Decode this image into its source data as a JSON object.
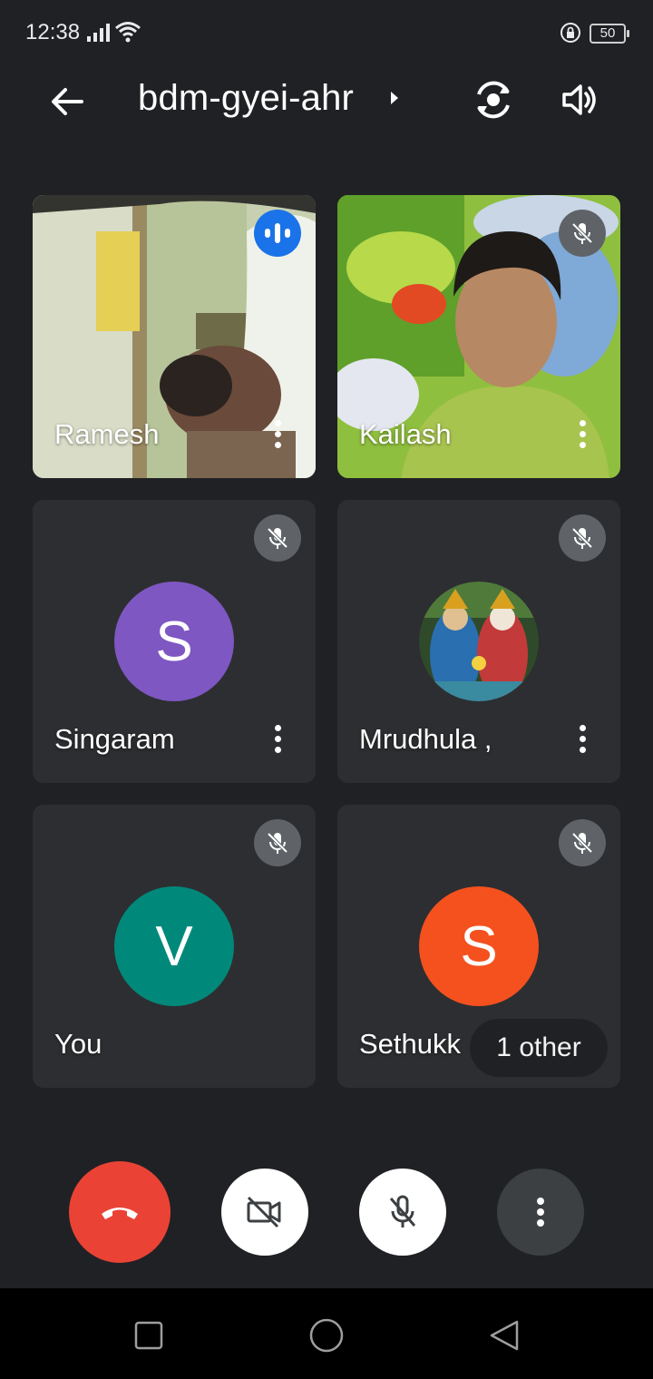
{
  "status": {
    "time": "12:38",
    "battery": "50"
  },
  "meeting": {
    "code": "bdm-gyei-ahr"
  },
  "participants": [
    {
      "name": "Ramesh",
      "state": "speaking"
    },
    {
      "name": "Kailash",
      "state": "muted"
    },
    {
      "name": "Singaram",
      "initial": "S",
      "avatar_color": "#7e57c2",
      "state": "muted"
    },
    {
      "name": "Mrudhula ,",
      "state": "muted"
    },
    {
      "name": "You",
      "initial": "V",
      "avatar_color": "#00897b",
      "state": "muted"
    },
    {
      "name": "Sethukk",
      "initial": "S",
      "avatar_color": "#f4511e",
      "state": "muted"
    }
  ],
  "others_label": "1 other",
  "controls": {
    "end_color": "#ea4335",
    "icons": [
      "end-call-icon",
      "camera-off-icon",
      "mic-off-icon",
      "more-vert-icon"
    ]
  }
}
